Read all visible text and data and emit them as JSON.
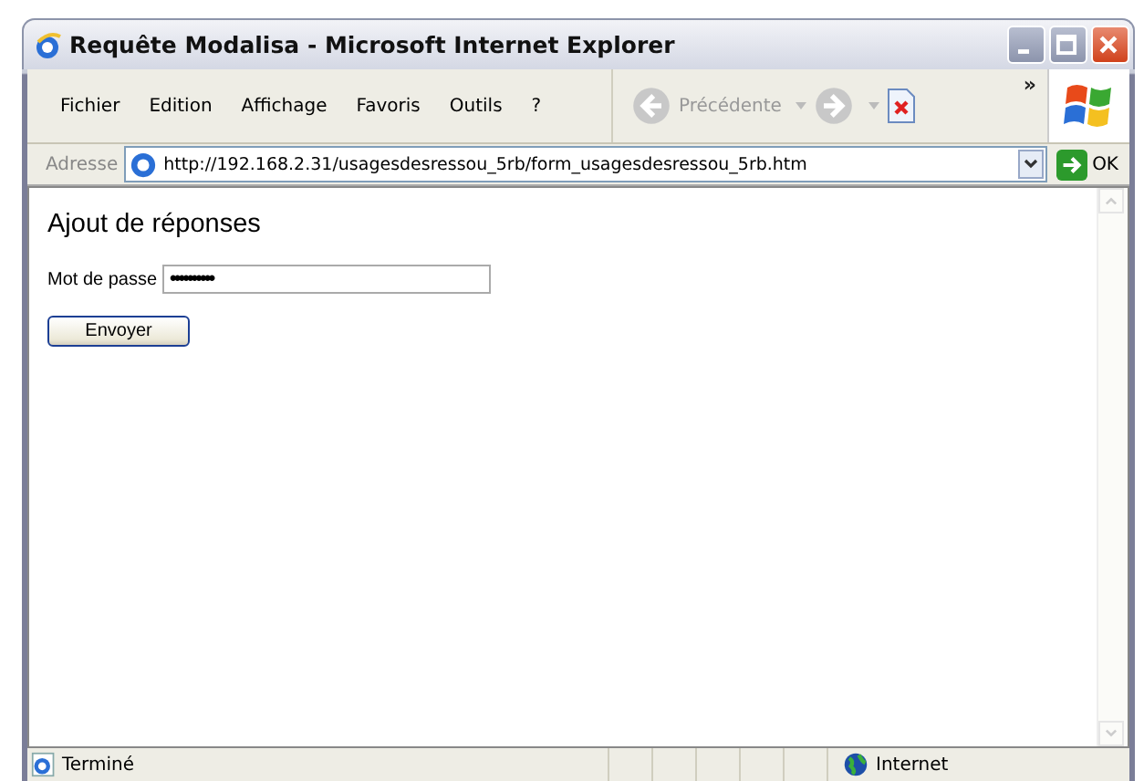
{
  "window": {
    "title": "Requête Modalisa - Microsoft Internet Explorer"
  },
  "menu": [
    "Fichier",
    "Edition",
    "Affichage",
    "Favoris",
    "Outils",
    "?"
  ],
  "toolbar": {
    "back_label": "Précédente",
    "more": "»"
  },
  "address_bar": {
    "label": "Adresse",
    "url": "http://192.168.2.31/usagesdesressou_5rb/form_usagesdesressou_5rb.htm",
    "go_label": "OK"
  },
  "page": {
    "heading": "Ajout de réponses",
    "password_label": "Mot de passe",
    "password_value": "••••••••••",
    "submit": "Envoyer"
  },
  "status_bar": {
    "status": "Terminé",
    "zone": "Internet"
  }
}
